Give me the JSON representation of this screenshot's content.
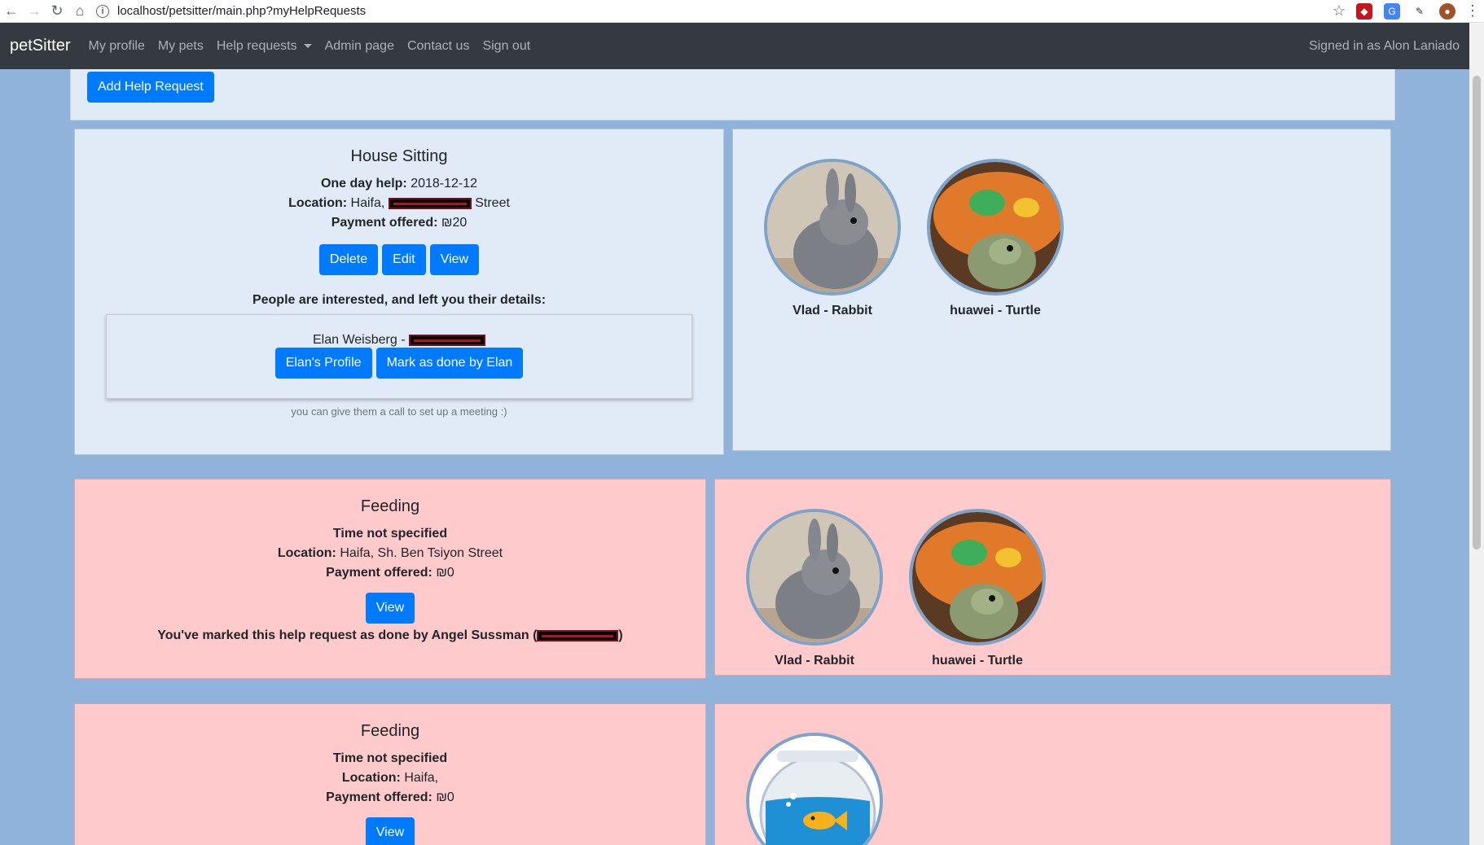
{
  "browser": {
    "url": "localhost/petsitter/main.php?myHelpRequests"
  },
  "navbar": {
    "brand": "petSitter",
    "links": [
      "My profile",
      "My pets",
      "Help requests",
      "Admin page",
      "Contact us",
      "Sign out"
    ],
    "signed_in": "Signed in as Alon Laniado"
  },
  "top": {
    "add_button": "Add Help Request"
  },
  "requests": [
    {
      "title": "House Sitting",
      "when_label": "One day help:",
      "when_value": "2018-12-12",
      "location_label": "Location:",
      "location_prefix": "Haifa,",
      "location_suffix": "Street",
      "payment_label": "Payment offered:",
      "payment_value": "₪20",
      "buttons": {
        "delete": "Delete",
        "edit": "Edit",
        "view": "View"
      },
      "interested_title": "People are interested, and left you their details:",
      "interested_name": "Elan Weisberg -",
      "profile_button": "Elan's Profile",
      "mark_done_button": "Mark as done by Elan",
      "note": "you can give them a call to set up a meeting :)",
      "pets": [
        {
          "name": "Vlad - Rabbit",
          "icon": "rabbit-icon"
        },
        {
          "name": "huawei - Turtle",
          "icon": "turtle-icon"
        }
      ]
    },
    {
      "title": "Feeding",
      "when_label": "Time not specified",
      "location_label": "Location:",
      "location_value": "Haifa, Sh. Ben Tsiyon Street",
      "payment_label": "Payment offered:",
      "payment_value": "₪0",
      "view_button": "View",
      "done_text": "You've marked this help request as done by Angel Sussman (",
      "done_close": ")",
      "pets": [
        {
          "name": "Vlad - Rabbit",
          "icon": "rabbit-icon"
        },
        {
          "name": "huawei - Turtle",
          "icon": "turtle-icon"
        }
      ]
    },
    {
      "title": "Feeding",
      "when_label": "Time not specified",
      "location_label": "Location:",
      "location_value": "Haifa,",
      "payment_label": "Payment offered:",
      "payment_value": "₪0",
      "view_button": "View",
      "pets": [
        {
          "name": "",
          "icon": "fishbowl-icon"
        }
      ]
    }
  ],
  "colors": {
    "page_bg": "#8fb3db",
    "navbar": "#343a40",
    "primary": "#007bff",
    "card_blue": "#e1ebf7",
    "card_pink": "#ffcacb"
  }
}
